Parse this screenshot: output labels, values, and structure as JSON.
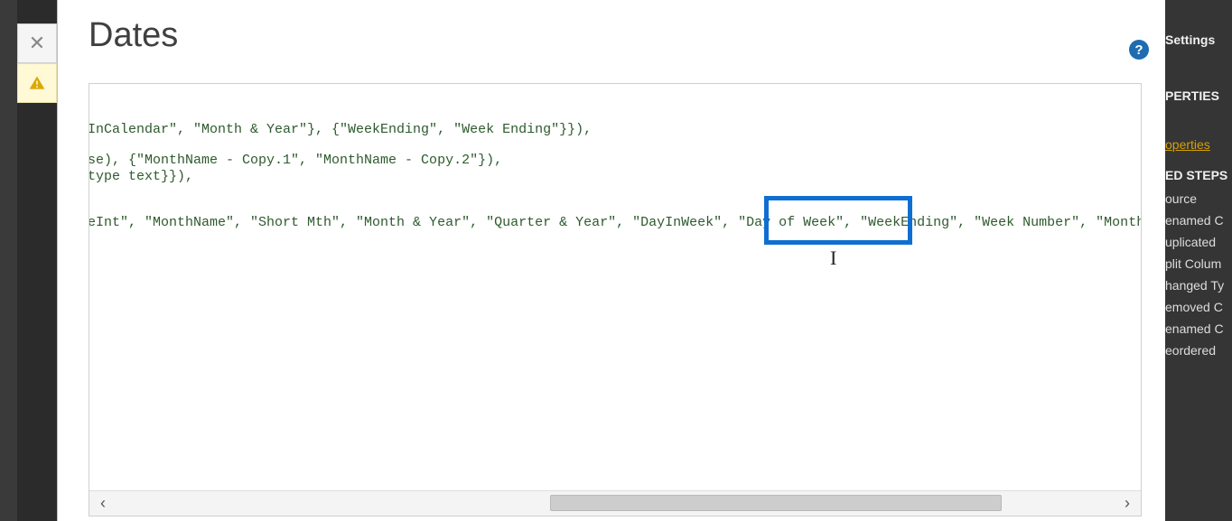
{
  "title": "Dates",
  "help_glyph": "?",
  "close_glyph": "✕",
  "code": {
    "line1": "InCalendar\", \"Month & Year\"}, {\"WeekEnding\", \"Week Ending\"}}),",
    "line2": "se), {\"MonthName - Copy.1\", \"MonthName - Copy.2\"}),",
    "line3": " type text}}),",
    "line4": "eInt\", \"MonthName\", \"Short Mth\", \"Month & Year\", \"Quarter & Year\", \"DayInWeek\", \"Day of Week\", \"WeekEnding\", \"Week Number\", \"MonthnYear\", \"Quar"
  },
  "right": {
    "settings": "Settings",
    "properties_hdr": "PERTIES",
    "properties_link": "operties",
    "applied_hdr": "ED STEPS",
    "steps": [
      "ource",
      "enamed C",
      "uplicated",
      "plit Colum",
      "hanged Ty",
      "emoved C",
      "enamed C",
      "eordered"
    ]
  },
  "scroll": {
    "left_glyph": "‹",
    "right_glyph": "›"
  }
}
